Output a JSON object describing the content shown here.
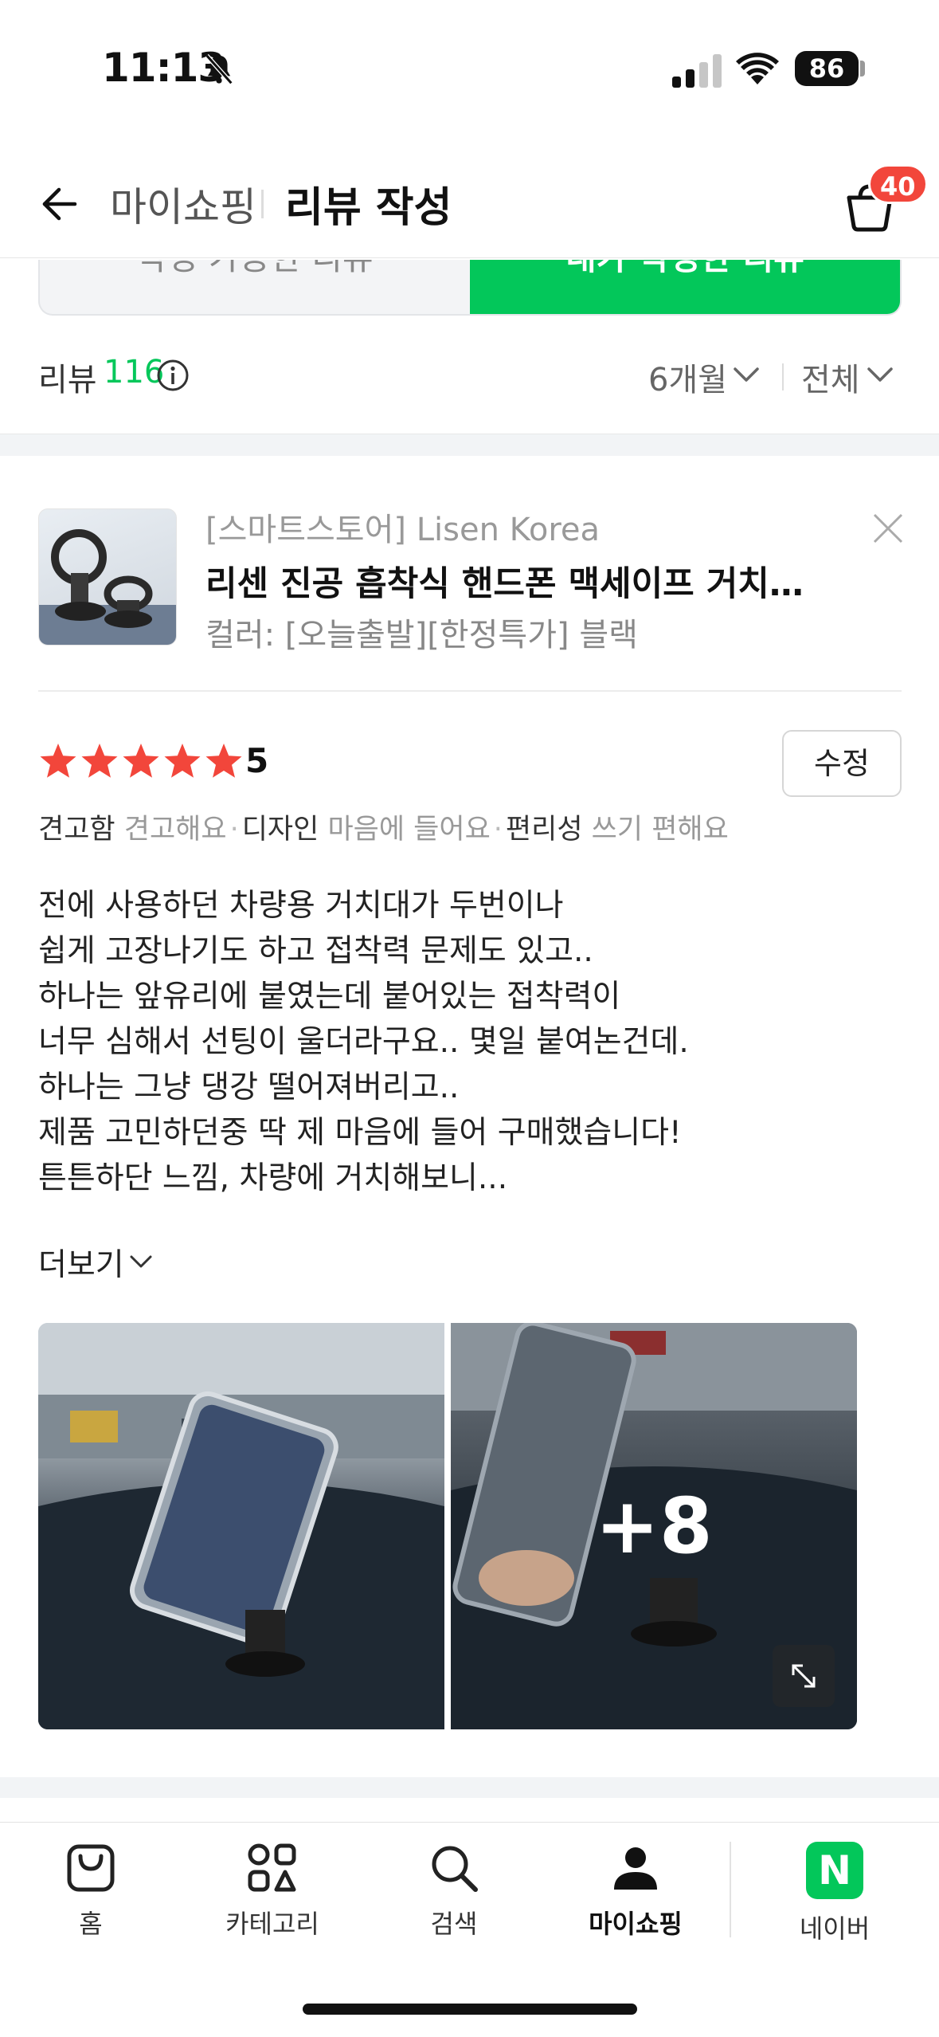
{
  "status_bar": {
    "time": "11:13",
    "battery": "86"
  },
  "header": {
    "breadcrumb": "마이쇼핑",
    "title": "리뷰 작성",
    "cart_count": "40"
  },
  "tabs": [
    {
      "label": "작성 가능한 리뷰",
      "active": false
    },
    {
      "label": "내가 작성한 리뷰",
      "active": true
    }
  ],
  "summary": {
    "label": "리뷰",
    "count": "116",
    "period": "6개월",
    "filter": "전체"
  },
  "review": {
    "store": "[스마트스토어] Lisen Korea",
    "product_name": "리센 진공 흡착식 핸드폰 맥세이프 거치대 ...",
    "option": "컬러: [오늘출발][한정특가] 블랙",
    "rating": "5",
    "edit_label": "수정",
    "attributes": [
      {
        "key": "견고함",
        "value": "견고해요"
      },
      {
        "key": "디자인",
        "value": "마음에 들어요"
      },
      {
        "key": "편리성",
        "value": "쓰기 편해요"
      }
    ],
    "text_lines": [
      "전에 사용하던 차량용 거치대가 두번이나",
      "쉽게 고장나기도 하고 접착력 문제도 있고..",
      "하나는 앞유리에 붙였는데 붙어있는 접착력이",
      "너무 심해서 선팅이 울더라구요.. 몇일 붙여논건데.",
      "하나는 그냥 댕강 떨어져버리고..",
      "제품 고민하던중 딱 제 마음에 들어 구매했습니다!",
      "튼튼하단 느낌, 차량에 거치해보니..."
    ],
    "more_label": "더보기",
    "more_photos": "+8"
  },
  "bottom_nav": [
    {
      "label": "홈",
      "icon": "shopping-bag-icon"
    },
    {
      "label": "카테고리",
      "icon": "category-icon"
    },
    {
      "label": "검색",
      "icon": "search-icon"
    },
    {
      "label": "마이쇼핑",
      "icon": "person-icon",
      "active": true
    },
    {
      "label": "네이버",
      "icon": "naver-icon"
    }
  ],
  "colors": {
    "accent": "#03c75a",
    "star": "#f2463b",
    "badge": "#f2463b"
  }
}
